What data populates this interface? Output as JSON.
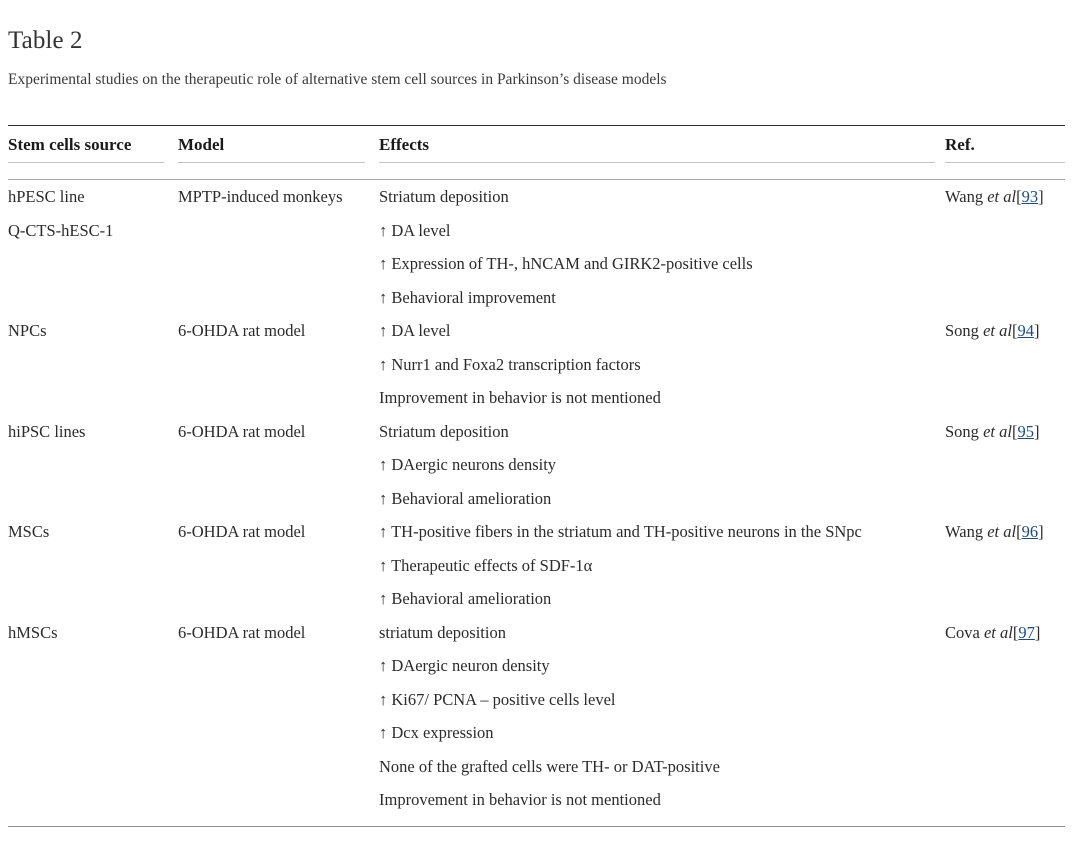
{
  "document": {
    "table_label": "Table 2",
    "caption": "Experimental studies on the therapeutic role of alternative stem cell sources in Parkinson’s disease models"
  },
  "colors": {
    "link": "#1b4b87",
    "text": "#2b2b2b",
    "rule_dark": "#2f2f2f",
    "rule_light": "#c3c3c3"
  },
  "table": {
    "headers": {
      "source": "Stem cells source",
      "model": "Model",
      "effects": "Effects",
      "ref": "Ref."
    },
    "rows": [
      {
        "source_lines": [
          "hPESC line",
          "Q-CTS-hESC-1"
        ],
        "model": "MPTP-induced monkeys",
        "effects": [
          "Striatum deposition",
          "↑ DA level",
          "↑ Expression of TH-, hNCAM and GIRK2-positive cells",
          "↑ Behavioral improvement"
        ],
        "ref_author": "Wang ",
        "ref_etal": "et al",
        "ref_number": "93"
      },
      {
        "source_lines": [
          "NPCs"
        ],
        "model": "6-OHDA rat model",
        "effects": [
          "↑ DA level",
          "↑ Nurr1 and Foxa2 transcription factors",
          "Improvement in behavior is not mentioned"
        ],
        "ref_author": "Song ",
        "ref_etal": "et al",
        "ref_number": "94"
      },
      {
        "source_lines": [
          "hiPSC lines"
        ],
        "model": "6-OHDA rat model",
        "effects": [
          "Striatum deposition",
          "↑ DAergic neurons density",
          "↑ Behavioral amelioration"
        ],
        "ref_author": "Song ",
        "ref_etal": "et al",
        "ref_number": "95"
      },
      {
        "source_lines": [
          "MSCs"
        ],
        "model": "6-OHDA rat model",
        "effects": [
          "↑ TH-positive fibers in the striatum and TH-positive neurons in the SNpc",
          "↑ Therapeutic effects of SDF-1α",
          "↑ Behavioral amelioration"
        ],
        "ref_author": "Wang ",
        "ref_etal": "et al",
        "ref_number": "96"
      },
      {
        "source_lines": [
          "hMSCs"
        ],
        "model": "6-OHDA rat model",
        "effects": [
          "striatum deposition",
          "↑ DAergic neuron density",
          "↑ Ki67/ PCNA – positive cells level",
          "↑ Dcx expression",
          "None of the grafted cells were TH- or DAT-positive",
          "Improvement in behavior is not mentioned"
        ],
        "ref_author": "Cova ",
        "ref_etal": "et al",
        "ref_number": "97"
      }
    ]
  }
}
